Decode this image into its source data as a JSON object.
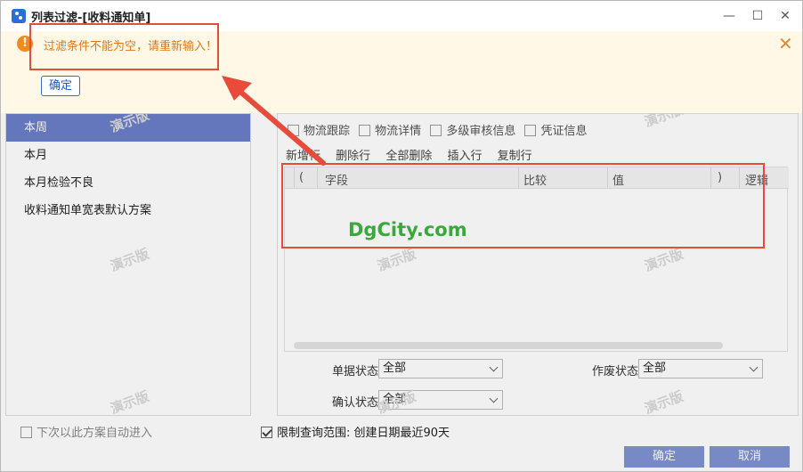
{
  "window": {
    "title": "列表过滤-[收料通知单]",
    "minimize_icon": "—",
    "maximize_icon": "☐",
    "close_icon": "✕"
  },
  "banner": {
    "message": "过滤条件不能为空，请重新输入！",
    "ok_label": "确定",
    "warn_glyph": "!",
    "close_glyph": "✕",
    "color": "#fff8e6"
  },
  "left_panel": {
    "items": [
      {
        "label": "本周",
        "active": true
      },
      {
        "label": "本月"
      },
      {
        "label": "本月检验不良"
      },
      {
        "label": "收料通知单宽表默认方案"
      }
    ],
    "auto_enter_label": "下次以此方案自动进入"
  },
  "right_panel": {
    "checkboxes_row2": [
      "物流跟踪",
      "物流详情",
      "多级审核信息",
      "凭证信息"
    ],
    "toolbar": [
      "新增行",
      "删除行",
      "全部删除",
      "插入行",
      "复制行"
    ],
    "grid_columns": [
      "(",
      "字段",
      "比较",
      "值",
      ")",
      "逻辑"
    ],
    "fields": {
      "doc_status_label": "单据状态",
      "doc_status_value": "全部",
      "void_status_label": "作废状态",
      "void_status_value": "全部",
      "confirm_status_label": "确认状态",
      "confirm_status_value": "全部"
    }
  },
  "limit_range": {
    "label": "限制查询范围: 创建日期最近90天",
    "checked": true
  },
  "buttons": {
    "ok": "确定",
    "cancel": "取消"
  },
  "watermark": "演示版",
  "annotation": {
    "site_text": "DgCity.com"
  }
}
